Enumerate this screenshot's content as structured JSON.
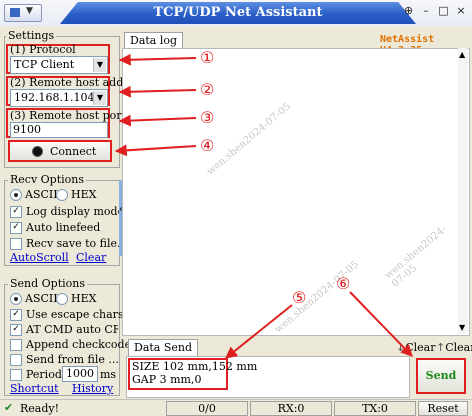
{
  "window": {
    "title": "TCP/UDP Net Assistant",
    "version": "NetAssist V4.3.25"
  },
  "settings": {
    "group_title": "Settings",
    "protocol_label": "(1) Protocol",
    "protocol_value": "TCP Client",
    "remote_addr_label": "(2) Remote host addr",
    "remote_addr_value": "192.168.1.104",
    "remote_port_label": "(3) Remote host port",
    "remote_port_value": "9100",
    "connect_label": "Connect"
  },
  "recv_options": {
    "group_title": "Recv Options",
    "ascii": "ASCII",
    "hex": "HEX",
    "log_display_mode": "Log display mode",
    "auto_linefeed": "Auto linefeed",
    "recv_save": "Recv save to file...",
    "autoscroll": "AutoScroll",
    "clear": "Clear"
  },
  "send_options": {
    "group_title": "Send Options",
    "ascii": "ASCII",
    "hex": "HEX",
    "use_escape": "Use escape chars",
    "at_cmd": "AT CMD auto CR+LF",
    "append_checkcode": "Append checkcode",
    "send_from_file": "Send from file ...",
    "period": "Period",
    "period_value": "1000",
    "period_unit": "ms",
    "shortcut": "Shortcut",
    "history": "History"
  },
  "log": {
    "tab": "Data log",
    "watermark_1": "wen.shen2024-07-05",
    "watermark_2": "wen.shen2024-07-05",
    "watermark_3": "wen.shen2024-07-05"
  },
  "send": {
    "tab": "Data Send",
    "clear1": "Clear",
    "clear2": "Clear",
    "line1": "SIZE 102 mm,152 mm",
    "line2": "GAP 3 mm,0",
    "send_button": "Send"
  },
  "annotations": {
    "n1": "①",
    "n2": "②",
    "n3": "③",
    "n4": "④",
    "n5": "⑤",
    "n6": "⑥"
  },
  "status": {
    "ready": "Ready!",
    "counter": "0/0",
    "rx": "RX:0",
    "tx": "TX:0",
    "reset": "Reset"
  },
  "colors": {
    "annotation": "#e02020",
    "title_blue": "#2a5fc8",
    "version": "#e07000",
    "send_text": "#1a8a1a",
    "link": "#0000cc"
  }
}
